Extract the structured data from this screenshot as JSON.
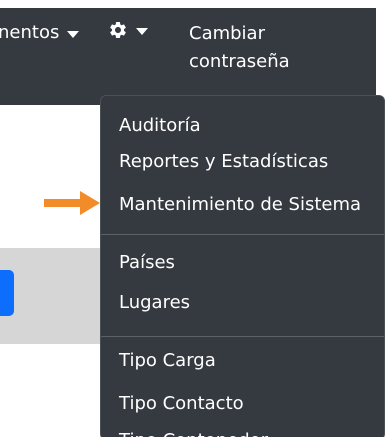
{
  "navbar": {
    "mantenimientos_label": "nentos",
    "gear_icon": "gear-icon",
    "cambiar_label_line1": "Cambiar",
    "cambiar_label_line2": "contraseña",
    "background": "#343a40"
  },
  "dropdown": {
    "items": [
      {
        "label": "Auditoría"
      },
      {
        "label": "Reportes y Estadísticas"
      },
      {
        "label": "Mantenimiento de Sistema"
      },
      {
        "label": "Países"
      },
      {
        "label": "Lugares"
      },
      {
        "label": "Tipo Carga"
      },
      {
        "label": "Tipo Contacto"
      },
      {
        "label": "Tipo Contenedor"
      }
    ]
  },
  "annotation": {
    "arrow_color": "#f28c28",
    "points_to": "Mantenimiento de Sistema"
  },
  "colors": {
    "menu_background": "#343a40",
    "primary_button": "#0d6efd",
    "panel_gray": "#d6d6d6"
  }
}
